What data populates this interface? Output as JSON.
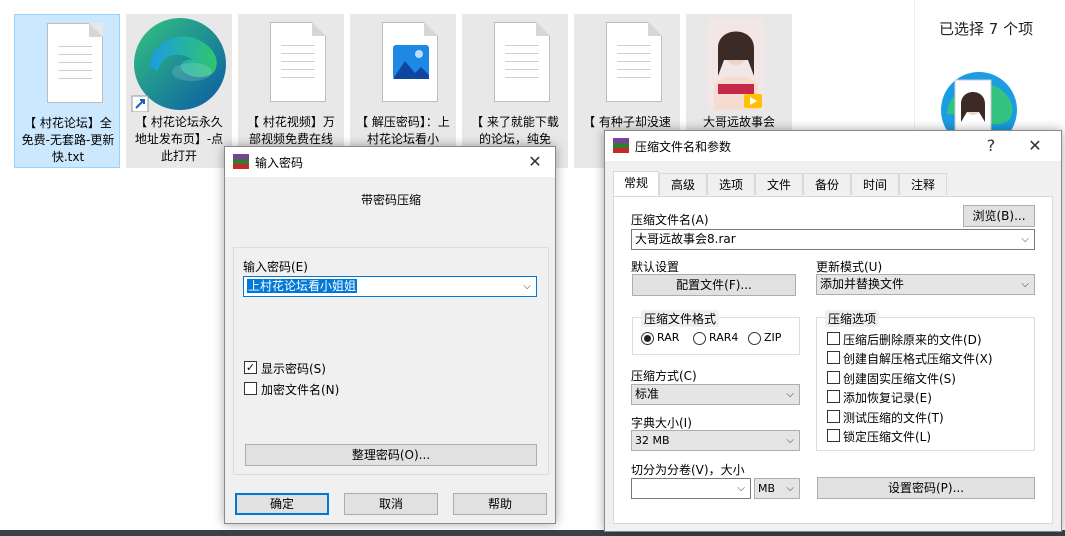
{
  "explorer": {
    "files": [
      {
        "caption": "【 村花论坛】全免费-无套路-更新快.txt",
        "icon": "text-file-icon",
        "selected": true
      },
      {
        "caption": "【 村花论坛永久地址发布页】-点此打开",
        "icon": "edge-shortcut-icon",
        "selected": false
      },
      {
        "caption": "【 村花视频】万部视频免费在线",
        "icon": "text-file-icon",
        "selected": false
      },
      {
        "caption": "【 解压密码】：上村花论坛看小",
        "icon": "image-file-icon",
        "selected": false
      },
      {
        "caption": "【 来了就能下载的论坛，纯免",
        "icon": "text-file-icon",
        "selected": false
      },
      {
        "caption": "【 有种子却没速度?",
        "icon": "text-file-icon",
        "selected": false
      },
      {
        "caption": "大哥远故事会",
        "icon": "video-thumbnail-icon",
        "selected": false
      }
    ],
    "details_pane_title": "已选择 7 个项"
  },
  "password_dialog": {
    "title": "输入密码",
    "close_glyph": "✕",
    "heading": "带密码压缩",
    "password_label": "输入密码(E)",
    "password_value": "上村花论坛看小姐姐",
    "show_password": {
      "label": "显示密码(S)",
      "checked": true
    },
    "encrypt_names": {
      "label": "加密文件名(N)",
      "checked": false
    },
    "organize_button": "整理密码(O)...",
    "ok_button": "确定",
    "cancel_button": "取消",
    "help_button": "帮助"
  },
  "archive_dialog": {
    "title": "压缩文件名和参数",
    "help_glyph": "?",
    "close_glyph": "✕",
    "tabs": [
      "常规",
      "高级",
      "选项",
      "文件",
      "备份",
      "时间",
      "注释"
    ],
    "active_tab": "常规",
    "archive_name_label": "压缩文件名(A)",
    "archive_name_value": "大哥远故事会8.rar",
    "browse_button": "浏览(B)...",
    "default_settings_label": "默认设置",
    "profiles_button": "配置文件(F)...",
    "update_mode_label": "更新模式(U)",
    "update_mode_value": "添加并替换文件",
    "format_group": "压缩文件格式",
    "formats": [
      {
        "label": "RAR",
        "checked": true
      },
      {
        "label": "RAR4",
        "checked": false
      },
      {
        "label": "ZIP",
        "checked": false
      }
    ],
    "options_group": "压缩选项",
    "options": [
      {
        "label": "压缩后删除原来的文件(D)",
        "checked": false
      },
      {
        "label": "创建自解压格式压缩文件(X)",
        "checked": false
      },
      {
        "label": "创建固实压缩文件(S)",
        "checked": false
      },
      {
        "label": "添加恢复记录(E)",
        "checked": false
      },
      {
        "label": "测试压缩的文件(T)",
        "checked": false
      },
      {
        "label": "锁定压缩文件(L)",
        "checked": false
      }
    ],
    "method_label": "压缩方式(C)",
    "method_value": "标准",
    "dict_label": "字典大小(I)",
    "dict_value": "32 MB",
    "split_label": "切分为分卷(V)，大小",
    "split_value": "",
    "split_unit": "MB",
    "set_password_button": "设置密码(P)..."
  },
  "colors": {
    "selection": "#cce8ff",
    "accent": "#0078d7",
    "dialog_bg": "#f0f0f0"
  }
}
